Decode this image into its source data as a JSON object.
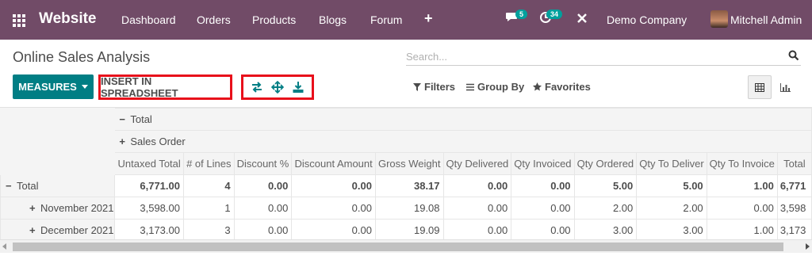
{
  "navbar": {
    "brand": "Website",
    "items": [
      "Dashboard",
      "Orders",
      "Products",
      "Blogs",
      "Forum"
    ],
    "plus": "+",
    "messages_count": "5",
    "activities_count": "34",
    "company": "Demo Company",
    "user": "Mitchell Admin",
    "color": "#714b67"
  },
  "control": {
    "title": "Online Sales Analysis",
    "search_placeholder": "Search...",
    "measures_label": "MEASURES",
    "insert_label": "INSERT IN SPREADSHEET",
    "filters_label": "Filters",
    "groupby_label": "Group By",
    "favorites_label": "Favorites",
    "accent": "#017e84",
    "highlight": "#e8101b"
  },
  "pivot": {
    "col_total_label": "Total",
    "col_group_label": "Sales Order",
    "measures": [
      "Untaxed Total",
      "# of Lines",
      "Discount %",
      "Discount Amount",
      "Gross Weight",
      "Qty Delivered",
      "Qty Invoiced",
      "Qty Ordered",
      "Qty To Deliver",
      "Qty To Invoice",
      "Total"
    ],
    "rows": [
      {
        "label": "Total",
        "values": [
          "6,771.00",
          "4",
          "0.00",
          "0.00",
          "38.17",
          "0.00",
          "0.00",
          "5.00",
          "5.00",
          "1.00",
          "6,771"
        ]
      },
      {
        "label": "November 2021",
        "values": [
          "3,598.00",
          "1",
          "0.00",
          "0.00",
          "19.08",
          "0.00",
          "0.00",
          "2.00",
          "2.00",
          "0.00",
          "3,598"
        ]
      },
      {
        "label": "December 2021",
        "values": [
          "3,173.00",
          "3",
          "0.00",
          "0.00",
          "19.09",
          "0.00",
          "0.00",
          "3.00",
          "3.00",
          "1.00",
          "3,173"
        ]
      }
    ]
  }
}
